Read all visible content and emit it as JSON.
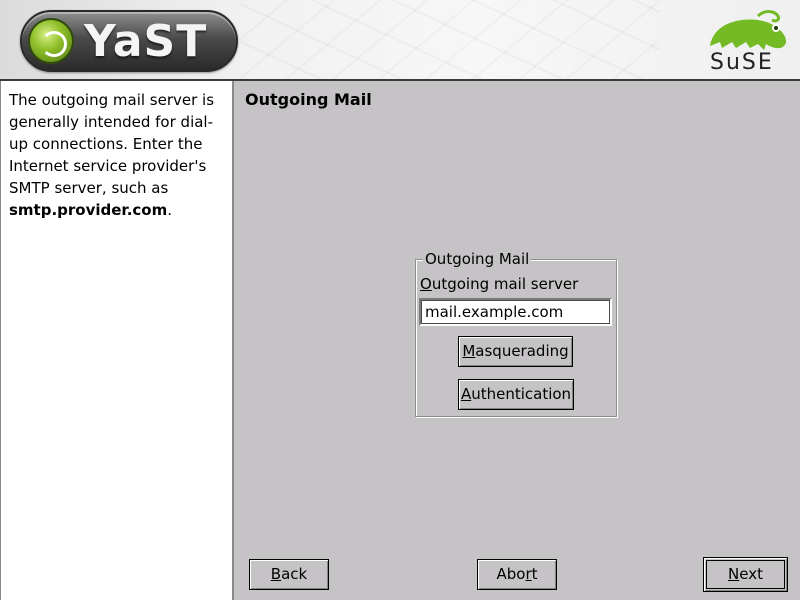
{
  "header": {
    "app_logo_text": "YaST",
    "vendor_logo_text": "SuSE"
  },
  "help": {
    "text_before": "The outgoing mail server is generally intended for dial-up connections. Enter the Internet service provider's SMTP server, such as ",
    "example_server": "smtp.provider.com",
    "text_after": "."
  },
  "page": {
    "title": "Outgoing Mail"
  },
  "outgoing_mail": {
    "group_label": "Outgoing Mail",
    "server_label_mnemonic": "O",
    "server_label_rest": "utgoing mail server",
    "server_value": "mail.example.com",
    "masquerading_mnemonic": "M",
    "masquerading_rest": "asquerading",
    "authentication_mnemonic": "A",
    "authentication_rest": "uthentication"
  },
  "navigation": {
    "back_mnemonic": "B",
    "back_rest": "ack",
    "abort_before": "Abo",
    "abort_mnemonic": "r",
    "abort_after": "t",
    "next_mnemonic": "N",
    "next_rest": "ext"
  },
  "colors": {
    "dialog_background": "#c6c3c6",
    "help_background": "#ffffff",
    "logo_green": "#8fbf2a"
  }
}
